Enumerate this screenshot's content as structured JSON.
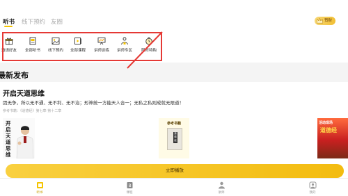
{
  "tabs": [
    {
      "label": "听书",
      "active": true
    },
    {
      "label": "线下预约",
      "active": false
    },
    {
      "label": "友圈",
      "active": false
    }
  ],
  "badge": {
    "label": "赞财"
  },
  "categories": [
    {
      "label": "邀请好友",
      "icon": "gift-icon"
    },
    {
      "label": "全部听书",
      "icon": "book-icon"
    },
    {
      "label": "线下预约",
      "icon": "image-icon"
    },
    {
      "label": "全部课程",
      "icon": "course-icon"
    },
    {
      "label": "讲师训练",
      "icon": "presentation-icon"
    },
    {
      "label": "讲师专区",
      "icon": "speaker-icon"
    },
    {
      "label": "限时特购",
      "icon": "timer-icon"
    }
  ],
  "section": {
    "title": "最新发布"
  },
  "card": {
    "title": "开启天道思维",
    "desc": "因无争，所以无不通、无不利、无不治；形神统一方能天人合一；无私之私则成就无限道！",
    "ref": "参考书籍：《道德经》第七章-第十二章",
    "thumb1_text": "开启天道思维",
    "thumb2_title": "参考书籍",
    "thumb2_book": "道德经",
    "thumb3_title": "活动现场",
    "thumb3_sub": "道德经",
    "play_label": "立即播放"
  },
  "bottom_nav": [
    {
      "label": "听书",
      "icon": "headphones-book-icon",
      "active": true
    },
    {
      "label": "课程",
      "icon": "course-icon",
      "active": false
    },
    {
      "label": "讲师",
      "icon": "speaker-icon",
      "active": false
    },
    {
      "label": "我的",
      "icon": "user-icon",
      "active": false
    }
  ],
  "colors": {
    "accent": "#F5C400",
    "highlight_box": "#E53935"
  }
}
